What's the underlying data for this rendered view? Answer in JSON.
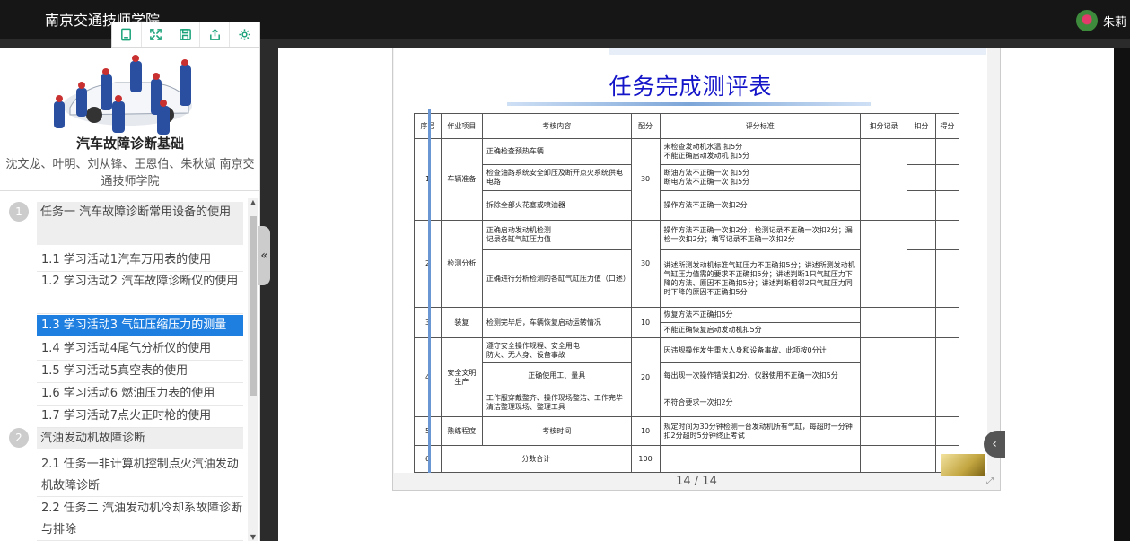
{
  "app": {
    "title": "南京交通技师学院",
    "user_name": "朱莉"
  },
  "toolbar": {
    "icons": [
      "document-icon",
      "fullscreen-icon",
      "save-icon",
      "share-icon",
      "settings-icon"
    ]
  },
  "book": {
    "title": "汽车故障诊断基础",
    "authors": "沈文龙、叶明、刘从锋、王恩伯、朱秋斌 南京交通技师学院"
  },
  "toc": {
    "chapters": [
      {
        "num": "1",
        "title": "任务一 汽车故障诊断常用设备的使用"
      },
      {
        "num": "2",
        "title": "汽油发动机故障诊断"
      }
    ],
    "sections": [
      {
        "title": "1.1  学习活动1汽车万用表的使用"
      },
      {
        "title": "1.2  学习活动2 汽车故障诊断仪的使用"
      },
      {
        "title": "1.3  学习活动3 气缸压缩压力的测量"
      },
      {
        "title": "1.4  学习活动4尾气分析仪的使用"
      },
      {
        "title": "1.5  学习活动5真空表的使用"
      },
      {
        "title": "1.6  学习活动6 燃油压力表的使用"
      },
      {
        "title": "1.7  学习活动7点火正时枪的使用"
      },
      {
        "title": "2.1  任务一非计算机控制点火汽油发动机故障诊断"
      },
      {
        "title": "2.2  任务二 汽油发动机冷却系故障诊断与排除"
      }
    ]
  },
  "slide": {
    "title": "任务完成测评表",
    "headers": [
      "序号",
      "作业项目",
      "考核内容",
      "配分",
      "评分标准",
      "扣分记录",
      "扣分",
      "得分"
    ],
    "rows": [
      {
        "no": "1",
        "item": "车辆准备",
        "score": "30",
        "content": [
          "正确检查预热车辆",
          "检查油路系统安全卸压及断开点火系统供电电路",
          "拆除全部火花塞或喷油器"
        ],
        "criteria": [
          "未检查发动机水温 扣5分\n不能正确启动发动机 扣5分",
          "断油方法不正确一次 扣5分\n断电方法不正确一次 扣5分",
          "操作方法不正确一次扣2分"
        ]
      },
      {
        "no": "2",
        "item": "检测分析",
        "score": "30",
        "content": [
          "正确启动发动机检测\n记录各缸气缸压力值",
          "正确进行分析检测的各缸气缸压力值（口述）"
        ],
        "criteria": [
          "操作方法不正确一次扣2分；检测记录不正确一次扣2分；漏检一次扣2分；填写记录不正确一次扣2分",
          "讲述所测发动机标准气缸压力不正确扣5分；讲述所测发动机气缸压力值需的要求不正确扣5分；讲述判断1只气缸压力下降的方法、原因不正确扣5分；讲述判断相邻2只气缸压力同时下降的原因不正确扣5分"
        ]
      },
      {
        "no": "3",
        "item": "装复",
        "score": "10",
        "content": [
          "检测完毕后，车辆恢复启动运转情况"
        ],
        "criteria": [
          "恢复方法不正确扣5分",
          "不能正确恢复启动发动机扣5分"
        ]
      },
      {
        "no": "4",
        "item": "安全文明生产",
        "score": "20",
        "content": [
          "遵守安全操作规程、安全用电\n防火、无人身、设备事故",
          "正确使用工、量具",
          "工作服穿戴整齐、操作现场整洁、工作完毕清洁整理现场、整理工具"
        ],
        "criteria": [
          "因违规操作发生重大人身和设备事故、此项按0分计",
          "每出现一次操作错误扣2分、仪器使用不正确一次扣5分",
          "不符合要求一次扣2分"
        ]
      },
      {
        "no": "5",
        "item": "熟练程度",
        "score": "10",
        "content": [
          "考核时间"
        ],
        "criteria": [
          "规定时间为30分钟检测一台发动机所有气缸，每超时一分钟扣2分超时5分钟终止考试"
        ]
      },
      {
        "no": "6",
        "item": "分数合计",
        "score": "100"
      }
    ]
  },
  "pager": {
    "text": "14 / 14"
  }
}
